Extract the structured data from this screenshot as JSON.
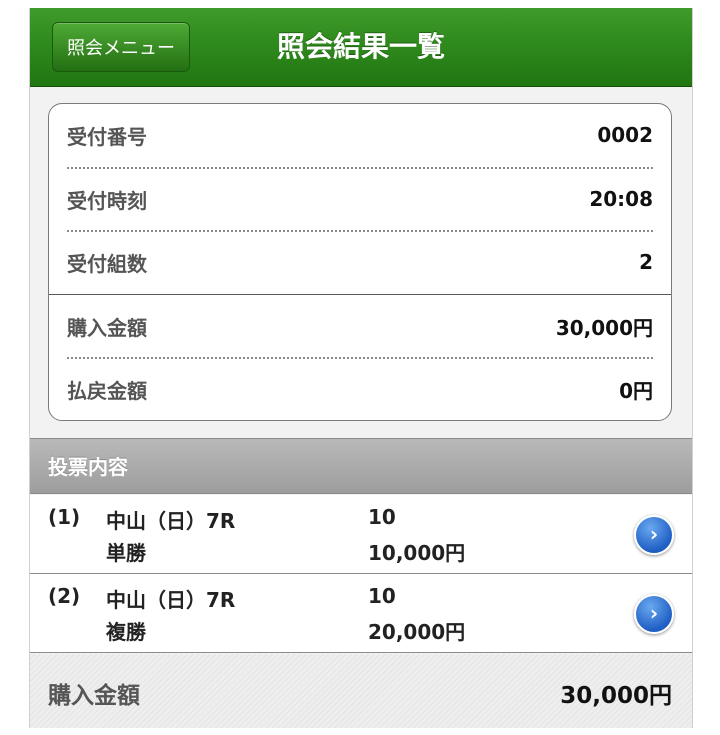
{
  "header": {
    "back_label": "照会メニュー",
    "title": "照会結果一覧"
  },
  "info": {
    "rows": [
      {
        "label": "受付番号",
        "value": "0002"
      },
      {
        "label": "受付時刻",
        "value": "20:08"
      },
      {
        "label": "受付組数",
        "value": "2"
      },
      {
        "label": "購入金額",
        "value": "30,000円"
      },
      {
        "label": "払戻金額",
        "value": "0円"
      }
    ]
  },
  "section": {
    "title": "投票内容"
  },
  "bets": [
    {
      "num": "(1)",
      "venue": "中山（日）7R",
      "type": "単勝",
      "horse": "10",
      "amount": "10,000円",
      "icon": "chevron-right-icon"
    },
    {
      "num": "(2)",
      "venue": "中山（日）7R",
      "type": "複勝",
      "horse": "10",
      "amount": "20,000円",
      "icon": "chevron-right-icon"
    }
  ],
  "total": {
    "label": "購入金額",
    "value": "30,000円"
  },
  "colors": {
    "header_green": "#2f8a1d",
    "section_gray": "#a8a8a8",
    "chevron_blue": "#1f5fc4"
  }
}
